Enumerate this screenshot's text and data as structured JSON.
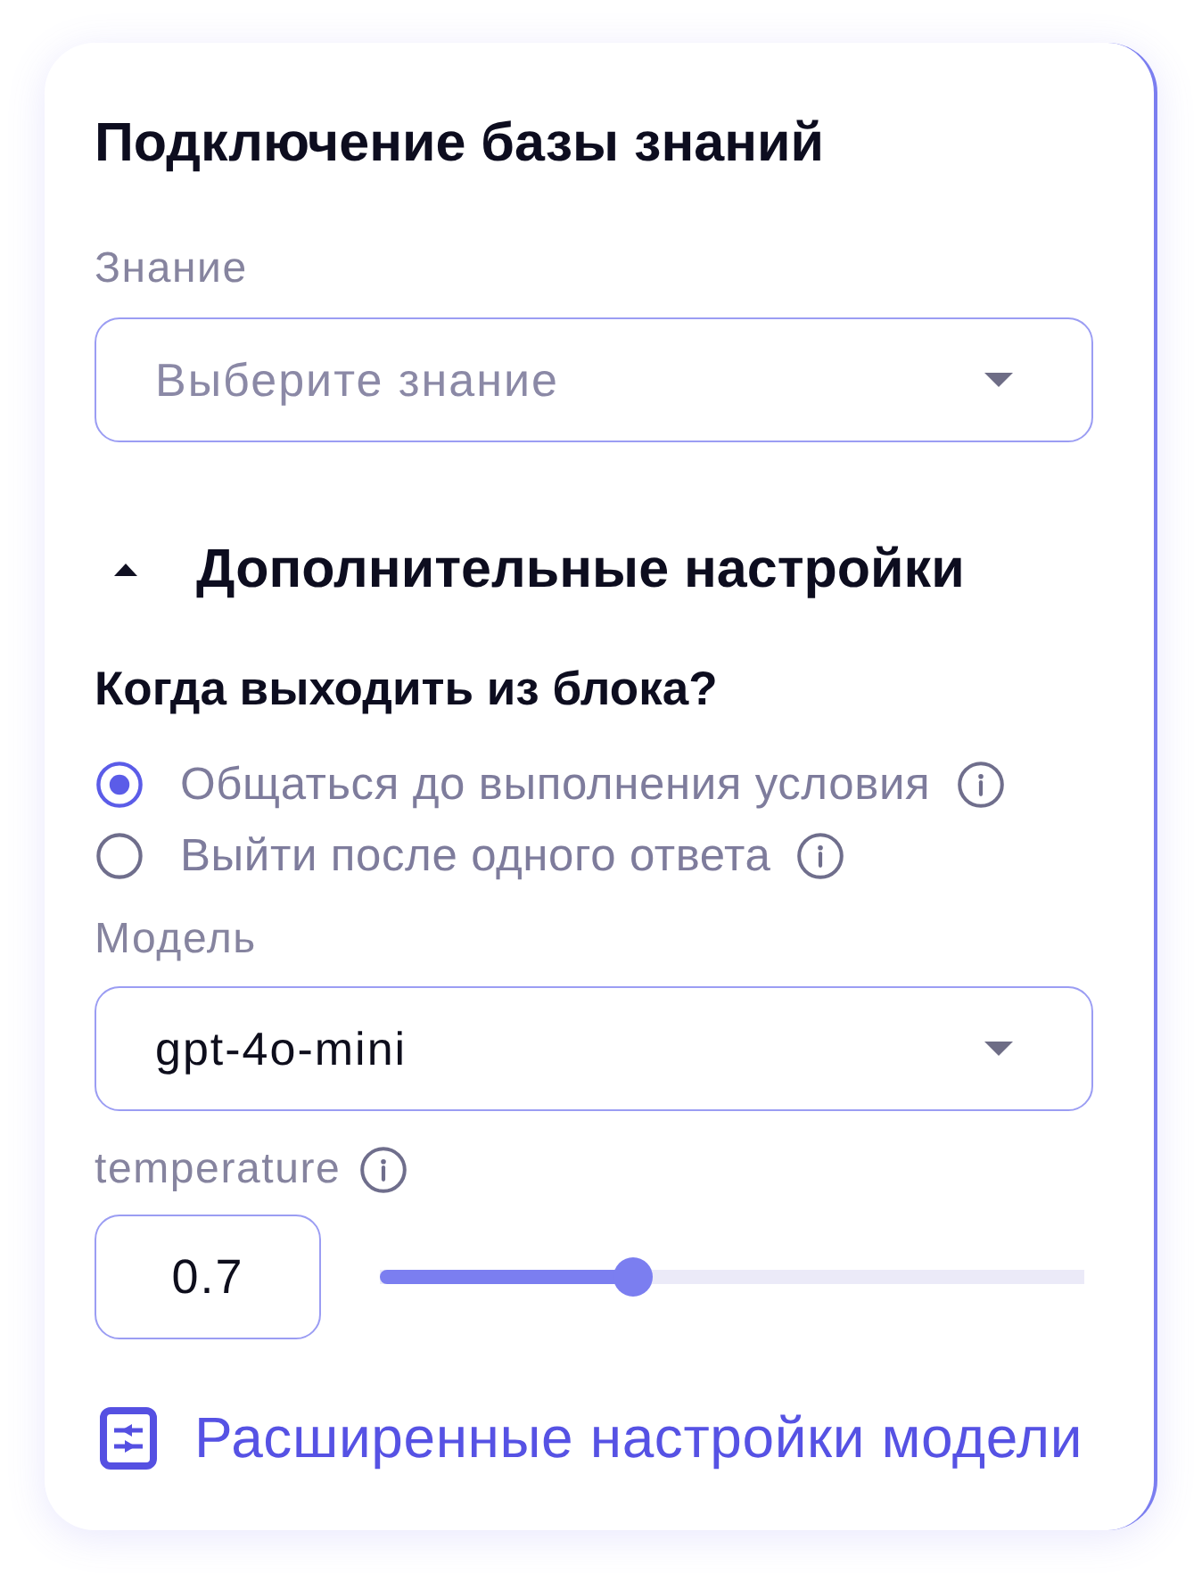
{
  "section": {
    "title": "Подключение базы знаний"
  },
  "knowledge": {
    "label": "Знание",
    "placeholder": "Выберите знание"
  },
  "advanced": {
    "title": "Дополнительные настройки",
    "expanded": true,
    "exit_question": "Когда выходить из блока?",
    "exit_options": [
      {
        "label": "Общаться до выполнения условия",
        "selected": true
      },
      {
        "label": "Выйти после одного ответа",
        "selected": false
      }
    ],
    "model": {
      "label": "Модель",
      "value": "gpt-4o-mini"
    },
    "temperature": {
      "label": "temperature",
      "value": "0.7",
      "level": 0.35
    },
    "link": "Расширенные настройки модели"
  }
}
